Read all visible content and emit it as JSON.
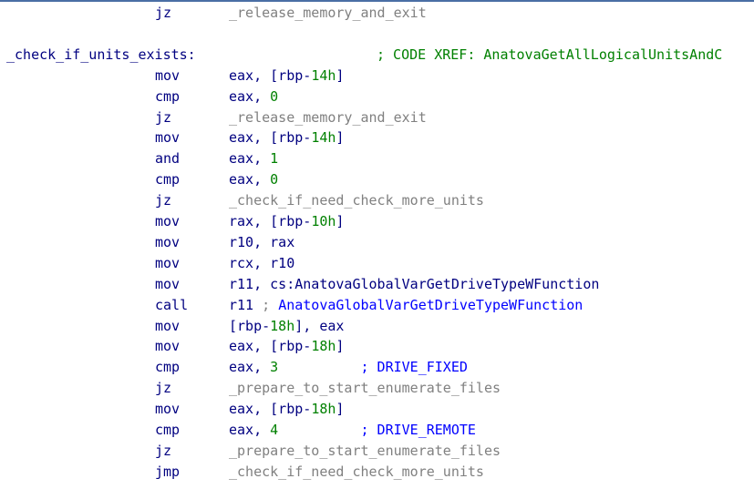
{
  "lines": [
    {
      "type": "insn",
      "mnemonic": "jz",
      "operands": [
        {
          "text": "_release_memory_and_exit",
          "cls": "loc"
        }
      ]
    },
    {
      "type": "blank"
    },
    {
      "type": "label",
      "label": "_check_if_units_exists:",
      "xref": "; CODE XREF: AnatovaGetAllLogicalUnitsAndC"
    },
    {
      "type": "insn",
      "mnemonic": "mov",
      "operands": [
        {
          "text": "eax, [rbp-",
          "cls": "kw"
        },
        {
          "text": "14h",
          "cls": "num"
        },
        {
          "text": "]",
          "cls": "kw"
        }
      ]
    },
    {
      "type": "insn",
      "mnemonic": "cmp",
      "operands": [
        {
          "text": "eax, ",
          "cls": "kw"
        },
        {
          "text": "0",
          "cls": "num"
        }
      ]
    },
    {
      "type": "insn",
      "mnemonic": "jz",
      "operands": [
        {
          "text": "_release_memory_and_exit",
          "cls": "loc"
        }
      ]
    },
    {
      "type": "insn",
      "mnemonic": "mov",
      "operands": [
        {
          "text": "eax, [rbp-",
          "cls": "kw"
        },
        {
          "text": "14h",
          "cls": "num"
        },
        {
          "text": "]",
          "cls": "kw"
        }
      ]
    },
    {
      "type": "insn",
      "mnemonic": "and",
      "operands": [
        {
          "text": "eax, ",
          "cls": "kw"
        },
        {
          "text": "1",
          "cls": "num"
        }
      ]
    },
    {
      "type": "insn",
      "mnemonic": "cmp",
      "operands": [
        {
          "text": "eax, ",
          "cls": "kw"
        },
        {
          "text": "0",
          "cls": "num"
        }
      ]
    },
    {
      "type": "insn",
      "mnemonic": "jz",
      "operands": [
        {
          "text": "_check_if_need_check_more_units",
          "cls": "loc"
        }
      ]
    },
    {
      "type": "insn",
      "mnemonic": "mov",
      "operands": [
        {
          "text": "rax, [rbp-",
          "cls": "kw"
        },
        {
          "text": "10h",
          "cls": "num"
        },
        {
          "text": "]",
          "cls": "kw"
        }
      ]
    },
    {
      "type": "insn",
      "mnemonic": "mov",
      "operands": [
        {
          "text": "r10, rax",
          "cls": "kw"
        }
      ]
    },
    {
      "type": "insn",
      "mnemonic": "mov",
      "operands": [
        {
          "text": "rcx, r10",
          "cls": "kw"
        }
      ]
    },
    {
      "type": "insn",
      "mnemonic": "mov",
      "operands": [
        {
          "text": "r11, cs:AnatovaGlobalVarGetDriveTypeWFunction",
          "cls": "kw"
        }
      ]
    },
    {
      "type": "insn",
      "mnemonic": "call",
      "operands": [
        {
          "text": "r11 ",
          "cls": "kw"
        },
        {
          "text": "; ",
          "cls": "gray-semi"
        },
        {
          "text": "AnatovaGlobalVarGetDriveTypeWFunction",
          "cls": "blue"
        }
      ]
    },
    {
      "type": "insn",
      "mnemonic": "mov",
      "operands": [
        {
          "text": "[rbp-",
          "cls": "kw"
        },
        {
          "text": "18h",
          "cls": "num"
        },
        {
          "text": "], eax",
          "cls": "kw"
        }
      ]
    },
    {
      "type": "insn",
      "mnemonic": "mov",
      "operands": [
        {
          "text": "eax, [rbp-",
          "cls": "kw"
        },
        {
          "text": "18h",
          "cls": "num"
        },
        {
          "text": "]",
          "cls": "kw"
        }
      ]
    },
    {
      "type": "insn",
      "mnemonic": "cmp",
      "operands": [
        {
          "text": "eax, ",
          "cls": "kw"
        },
        {
          "text": "3",
          "cls": "num"
        },
        {
          "text": "          ; DRIVE_FIXED",
          "cls": "blue"
        }
      ]
    },
    {
      "type": "insn",
      "mnemonic": "jz",
      "operands": [
        {
          "text": "_prepare_to_start_enumerate_files",
          "cls": "loc"
        }
      ]
    },
    {
      "type": "insn",
      "mnemonic": "mov",
      "operands": [
        {
          "text": "eax, [rbp-",
          "cls": "kw"
        },
        {
          "text": "18h",
          "cls": "num"
        },
        {
          "text": "]",
          "cls": "kw"
        }
      ]
    },
    {
      "type": "insn",
      "mnemonic": "cmp",
      "operands": [
        {
          "text": "eax, ",
          "cls": "kw"
        },
        {
          "text": "4",
          "cls": "num"
        },
        {
          "text": "          ; DRIVE_REMOTE",
          "cls": "blue"
        }
      ]
    },
    {
      "type": "insn",
      "mnemonic": "jz",
      "operands": [
        {
          "text": "_prepare_to_start_enumerate_files",
          "cls": "loc"
        }
      ]
    },
    {
      "type": "insn",
      "mnemonic": "jmp",
      "operands": [
        {
          "text": "_check_if_need_check_more_units",
          "cls": "loc"
        }
      ]
    },
    {
      "type": "sep",
      "text": "; ---------------------------------------------------------------------------"
    }
  ],
  "colors": {
    "mnemonic": "#000080",
    "register": "#000080",
    "number": "#008000",
    "location": "#808080",
    "comment_xref": "#008000",
    "comment_symbol": "#0000ff",
    "background": "#ffffff"
  }
}
